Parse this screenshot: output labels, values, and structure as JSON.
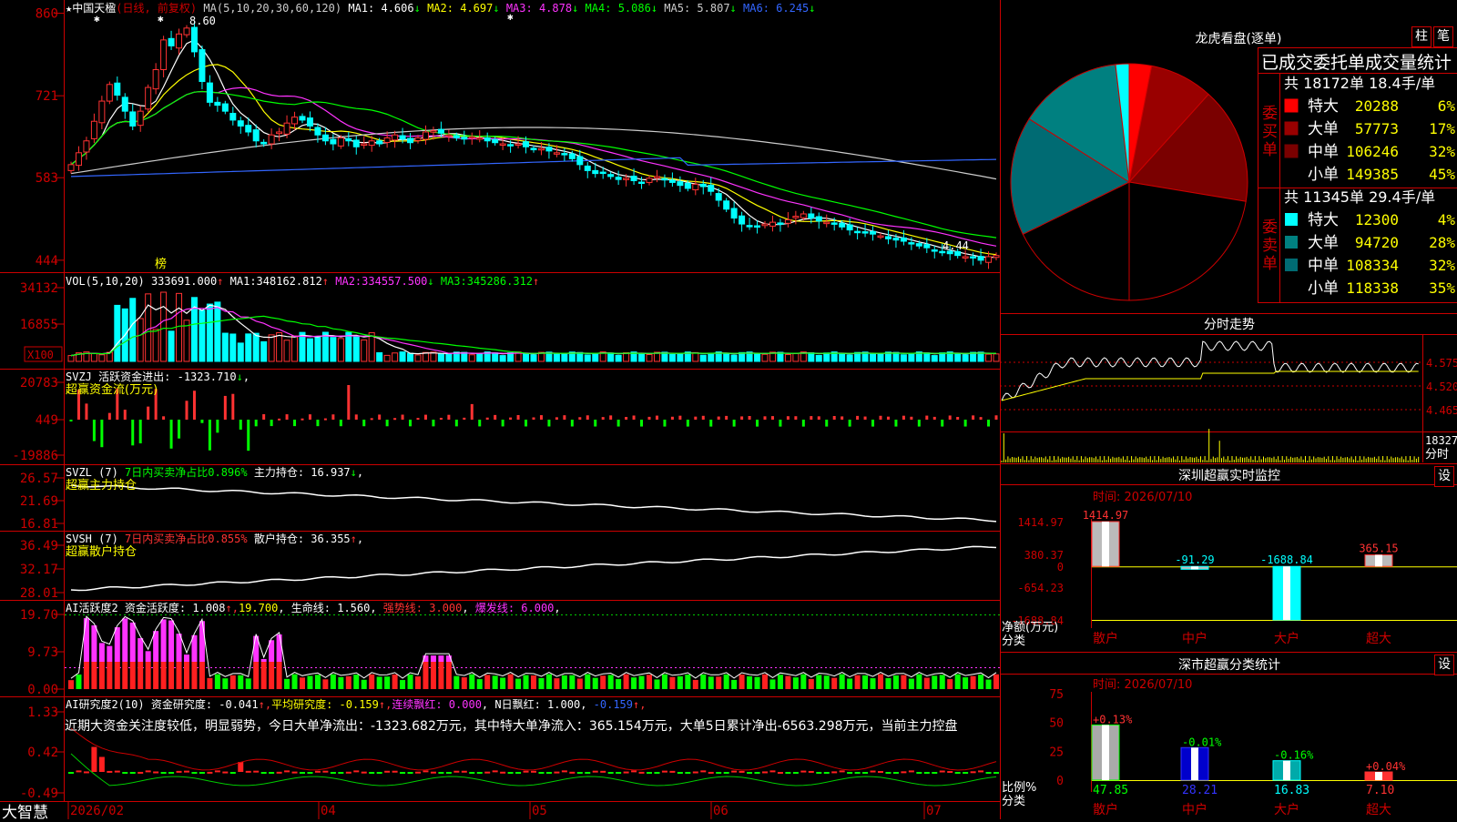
{
  "window": {
    "brand": "大智慧",
    "bang_label": "榜"
  },
  "header": {
    "star": "★",
    "stock_name": "中国天楹",
    "period_info": "(日线, 前复权)",
    "ma_label": "MA(5,10,20,30,60,120)",
    "ma_values": [
      {
        "label": "MA1:",
        "value": "4.606",
        "arrow": "↓",
        "color": "#ffffff"
      },
      {
        "label": "MA2:",
        "value": "4.697",
        "arrow": "↓",
        "color": "#ffff00"
      },
      {
        "label": "MA3:",
        "value": "4.878",
        "arrow": "↓",
        "color": "#ff33ff"
      },
      {
        "label": "MA4:",
        "value": "5.086",
        "arrow": "↓",
        "color": "#00ff00"
      },
      {
        "label": "MA5:",
        "value": "5.807",
        "arrow": "↓",
        "color": "#cccccc"
      },
      {
        "label": "MA6:",
        "value": "6.245",
        "arrow": "↓",
        "color": "#3366ff"
      }
    ]
  },
  "price_axis": {
    "ticks": [
      "860",
      "721",
      "583",
      "444"
    ]
  },
  "annotations": {
    "high_label": "8.60",
    "low_label": "4.44"
  },
  "volume_panel": {
    "title": "VOL(5,10,20)",
    "value": "333691.000",
    "ma1_label": "MA1:",
    "ma1": "348162.812",
    "ma2_label": "MA2:",
    "ma2": "334557.500",
    "ma3_label": "MA3:",
    "ma3": "345286.312",
    "ticks": [
      "34132",
      "16855"
    ],
    "unit": "X100"
  },
  "svzj_panel": {
    "title": "SVZJ",
    "line": "活跃资金进出: -1323.710",
    "arrow": "↓",
    "subtitle": "超赢资金流(万元)",
    "ticks": [
      "20783",
      "449",
      "-19886"
    ]
  },
  "svzl_panel": {
    "title": "SVZL (7)",
    "desc": "7日内买卖净占比0.896%",
    "holding": "主力持仓: 16.937",
    "arrow": "↓",
    "subtitle": "超赢主力持仓",
    "ticks": [
      "26.57",
      "21.69",
      "16.81"
    ]
  },
  "svsh_panel": {
    "title": "SVSH (7)",
    "desc": "7日内买卖净占比0.855%",
    "holding": "散户持仓: 36.355",
    "arrow": "↑",
    "subtitle": "超赢散户持仓",
    "ticks": [
      "36.49",
      "32.17",
      "28.01"
    ]
  },
  "ai_active_panel": {
    "title": "AI活跃度2",
    "active_label": "资金活跃度: 1.008",
    "v1": "19.700",
    "life_line": "生命线: 1.560",
    "strong_line": "强势线: 3.000",
    "burst_line": "爆发线: 6.000",
    "ticks": [
      "19.70",
      "9.73",
      "0.00"
    ]
  },
  "ai_research_panel": {
    "title": "AI研究度2(10)",
    "research": "资金研究度: -0.041",
    "avg": "平均研究度: -0.159",
    "streak": "连续飘红: 0.000",
    "ndays": "N日飘红: 1.000",
    "last": "-0.159",
    "ticks": [
      "1.33",
      "0.42",
      "-0.49"
    ],
    "narrative": "近期大资金关注度较低，明显弱势，今日大单净流出：-1323.682万元，其中特大单净流入：365.154万元，大单5日累计净出-6563.298万元，当前主力控盘"
  },
  "date_axis": {
    "labels": [
      "2026/02",
      "04",
      "05",
      "06",
      "07"
    ]
  },
  "right_panels": {
    "tab_bar": [
      "柱",
      "笔"
    ],
    "lhc_title": "龙虎看盘(逐单)",
    "stats_title": "已成交委托单成交量统计",
    "buy_label": "委买单",
    "sell_label": "委卖单",
    "buy_header": "共 18172单 18.4手/单",
    "sell_header": "共 11345单 29.4手/单",
    "buy_rows": [
      {
        "name": "特大",
        "volume": "20288",
        "pct": "6%",
        "color": "#ff0000"
      },
      {
        "name": "大单",
        "volume": "57773",
        "pct": "17%",
        "color": "#990000"
      },
      {
        "name": "中单",
        "volume": "106246",
        "pct": "32%",
        "color": "#7a0000"
      },
      {
        "name": "小单",
        "volume": "149385",
        "pct": "45%",
        "color": "#000000"
      }
    ],
    "sell_rows": [
      {
        "name": "特大",
        "volume": "12300",
        "pct": "4%",
        "color": "#00ffff"
      },
      {
        "name": "大单",
        "volume": "94720",
        "pct": "28%",
        "color": "#008080"
      },
      {
        "name": "中单",
        "volume": "108334",
        "pct": "32%",
        "color": "#006b73"
      },
      {
        "name": "小单",
        "volume": "118338",
        "pct": "35%",
        "color": "#000000"
      }
    ],
    "intraday_title": "分时走势",
    "intraday_ticks": [
      "4.575",
      "4.520",
      "4.465"
    ],
    "intraday_vol_label": "18327",
    "intraday_vol_unit": "分时",
    "monitor_title": "深圳超赢实时监控",
    "set_button": "设",
    "monitor_time": "时间: 2026/07/10",
    "monitor_ticks": [
      "1414.97",
      "380.37",
      "0",
      "-654.23",
      "-1688.84"
    ],
    "monitor_axis_label": "净额(万元)",
    "monitor_axis_label2": "分类",
    "category_stats_title": "深市超赢分类统计",
    "category_time": "时间: 2026/07/10",
    "category_ticks": [
      "75",
      "50",
      "25",
      "0"
    ],
    "category_axis_label": "比例%",
    "category_axis_label2": "分类"
  },
  "chart_data": [
    {
      "type": "candlestick",
      "title": "中国天楹 (日线, 前复权)",
      "ylim": [
        4.3,
        8.7
      ],
      "x_ticks": [
        "2026/02",
        "04",
        "05",
        "06",
        "07"
      ],
      "close": [
        6.05,
        6.25,
        6.45,
        6.78,
        7.12,
        7.4,
        7.22,
        6.95,
        6.7,
        6.95,
        7.35,
        7.65,
        8.15,
        8.05,
        8.25,
        8.35,
        7.95,
        7.45,
        7.1,
        7.05,
        6.95,
        6.8,
        6.7,
        6.6,
        6.45,
        6.4,
        6.55,
        6.6,
        6.75,
        6.85,
        6.8,
        6.7,
        6.55,
        6.45,
        6.4,
        6.5,
        6.45,
        6.35,
        6.4,
        6.45,
        6.4,
        6.5,
        6.55,
        6.48,
        6.42,
        6.5,
        6.6,
        6.62,
        6.58,
        6.55,
        6.5,
        6.48,
        6.52,
        6.5,
        6.45,
        6.42,
        6.4,
        6.38,
        6.4,
        6.35,
        6.3,
        6.32,
        6.28,
        6.25,
        6.22,
        6.15,
        6.05,
        5.95,
        5.9,
        5.92,
        5.85,
        5.8,
        5.82,
        5.78,
        5.75,
        5.82,
        5.85,
        5.8,
        5.75,
        5.7,
        5.65,
        5.72,
        5.68,
        5.6,
        5.45,
        5.3,
        5.15,
        5.05,
        5.02,
        5.0,
        5.05,
        5.08,
        5.05,
        5.12,
        5.18,
        5.22,
        5.15,
        5.1,
        5.08,
        5.05,
        5.0,
        4.95,
        4.92,
        4.9,
        4.88,
        4.85,
        4.8,
        4.78,
        4.76,
        4.72,
        4.68,
        4.65,
        4.6,
        4.58,
        4.55,
        4.52,
        4.5,
        4.48,
        4.44,
        4.5,
        4.52
      ],
      "high_annotation": "8.60",
      "low_annotation": "4.44"
    },
    {
      "type": "pie",
      "title": "龙虎看盘(逐单)",
      "categories": [
        "买特大",
        "买大单",
        "买中单",
        "买小单",
        "卖小单",
        "卖中单",
        "卖大单",
        "卖特大"
      ],
      "values": [
        20288,
        57773,
        106246,
        149385,
        118338,
        108334,
        94720,
        12300
      ]
    },
    {
      "type": "bar",
      "title": "深圳超赢实时监控",
      "categories": [
        "散户",
        "中户",
        "大户",
        "超大"
      ],
      "values": [
        1414.97,
        -91.29,
        -1688.84,
        365.15
      ],
      "ylim": [
        -1688.84,
        1414.97
      ]
    },
    {
      "type": "bar",
      "title": "深市超赢分类统计",
      "categories": [
        "散户",
        "中户",
        "大户",
        "超大"
      ],
      "values": [
        47.85,
        28.21,
        16.83,
        7.1
      ],
      "changes": [
        "+0.13%",
        "-0.01%",
        "-0.16%",
        "+0.04%"
      ],
      "ylim": [
        0,
        75
      ]
    }
  ]
}
